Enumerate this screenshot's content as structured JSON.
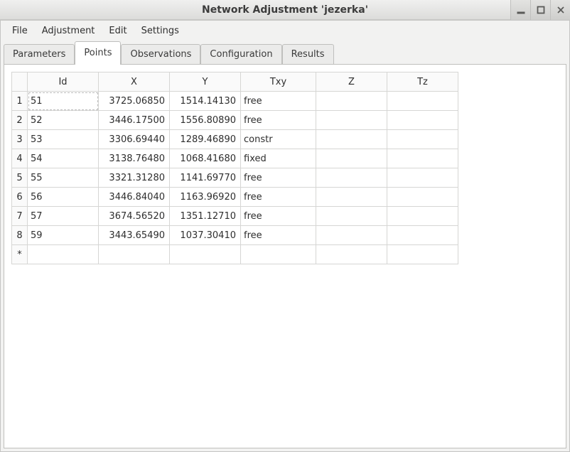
{
  "window": {
    "title": "Network Adjustment 'jezerka'"
  },
  "menu": {
    "items": [
      "File",
      "Adjustment",
      "Edit",
      "Settings"
    ]
  },
  "tabs": {
    "items": [
      "Parameters",
      "Points",
      "Observations",
      "Configuration",
      "Results"
    ],
    "active_index": 1
  },
  "table": {
    "columns": [
      "Id",
      "X",
      "Y",
      "Txy",
      "Z",
      "Tz"
    ],
    "rows": [
      {
        "n": "1",
        "id": "51",
        "x": "3725.06850",
        "y": "1514.14130",
        "txy": "free",
        "z": "",
        "tz": ""
      },
      {
        "n": "2",
        "id": "52",
        "x": "3446.17500",
        "y": "1556.80890",
        "txy": "free",
        "z": "",
        "tz": ""
      },
      {
        "n": "3",
        "id": "53",
        "x": "3306.69440",
        "y": "1289.46890",
        "txy": "constr",
        "z": "",
        "tz": ""
      },
      {
        "n": "4",
        "id": "54",
        "x": "3138.76480",
        "y": "1068.41680",
        "txy": "fixed",
        "z": "",
        "tz": ""
      },
      {
        "n": "5",
        "id": "55",
        "x": "3321.31280",
        "y": "1141.69770",
        "txy": "free",
        "z": "",
        "tz": ""
      },
      {
        "n": "6",
        "id": "56",
        "x": "3446.84040",
        "y": "1163.96920",
        "txy": "free",
        "z": "",
        "tz": ""
      },
      {
        "n": "7",
        "id": "57",
        "x": "3674.56520",
        "y": "1351.12710",
        "txy": "free",
        "z": "",
        "tz": ""
      },
      {
        "n": "8",
        "id": "59",
        "x": "3443.65490",
        "y": "1037.30410",
        "txy": "free",
        "z": "",
        "tz": ""
      }
    ],
    "new_row_marker": "*"
  }
}
